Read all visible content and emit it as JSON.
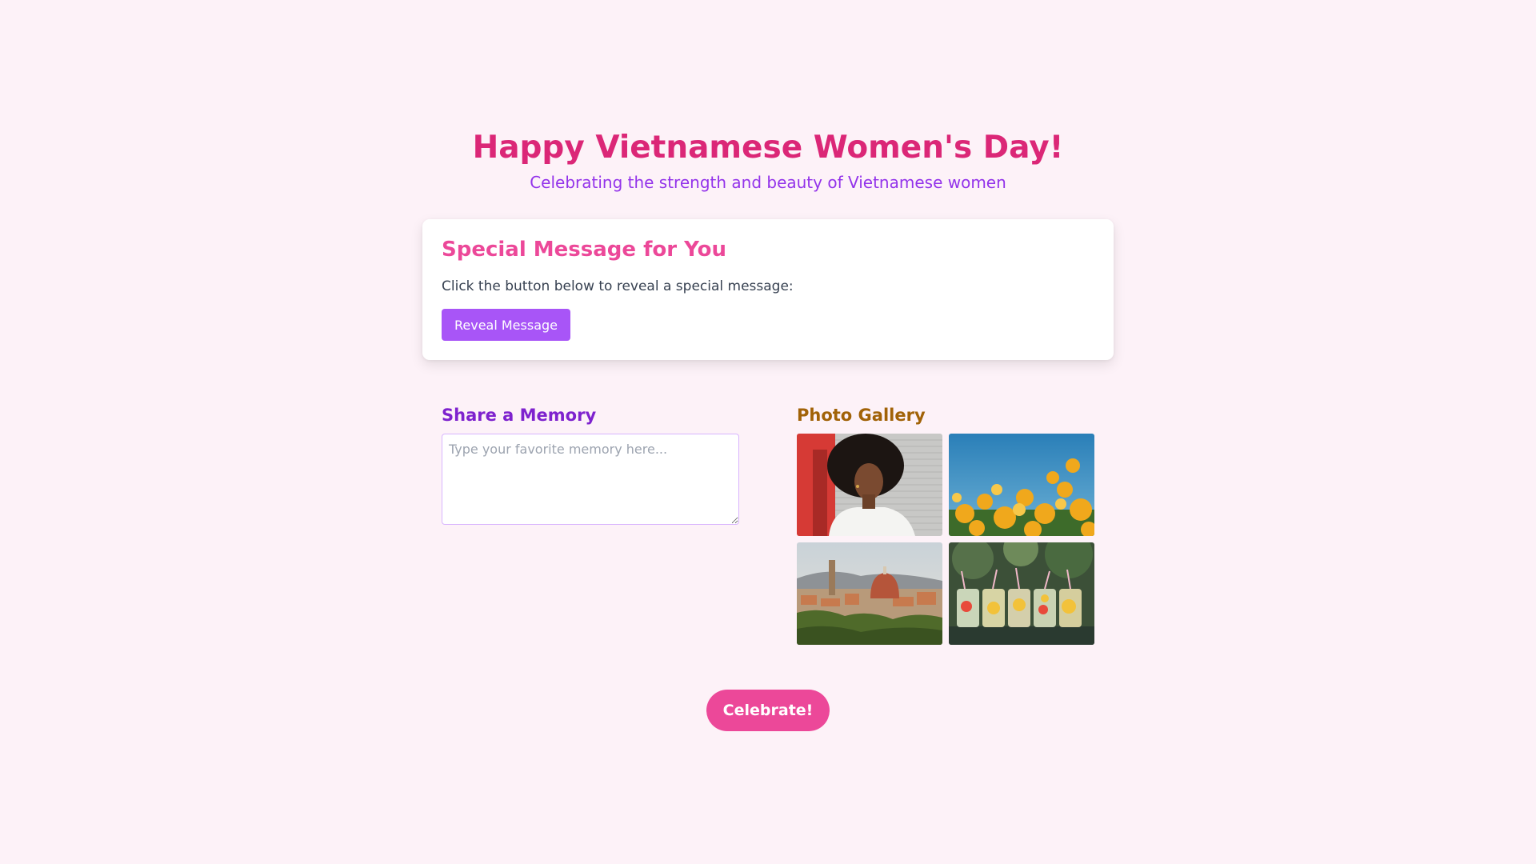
{
  "header": {
    "title": "Happy Vietnamese Women's Day!",
    "subtitle": "Celebrating the strength and beauty of Vietnamese women"
  },
  "message_card": {
    "title": "Special Message for You",
    "instruction": "Click the button below to reveal a special message:",
    "button_label": "Reveal Message"
  },
  "memory": {
    "title": "Share a Memory",
    "placeholder": "Type your favorite memory here...",
    "value": ""
  },
  "gallery": {
    "title": "Photo Gallery",
    "photos": [
      {
        "subject": "portrait-woman"
      },
      {
        "subject": "yellow-flowers"
      },
      {
        "subject": "city-cathedral"
      },
      {
        "subject": "lemonade-jars"
      }
    ]
  },
  "footer": {
    "celebrate_label": "Celebrate!"
  },
  "colors": {
    "background": "#fdf2f8",
    "title": "#db2777",
    "subtitle": "#9333ea",
    "card_title": "#ec4899",
    "reveal_button": "#a855f7",
    "memory_title": "#7e22ce",
    "gallery_title": "#a16207",
    "celebrate_button": "#ec4899"
  }
}
